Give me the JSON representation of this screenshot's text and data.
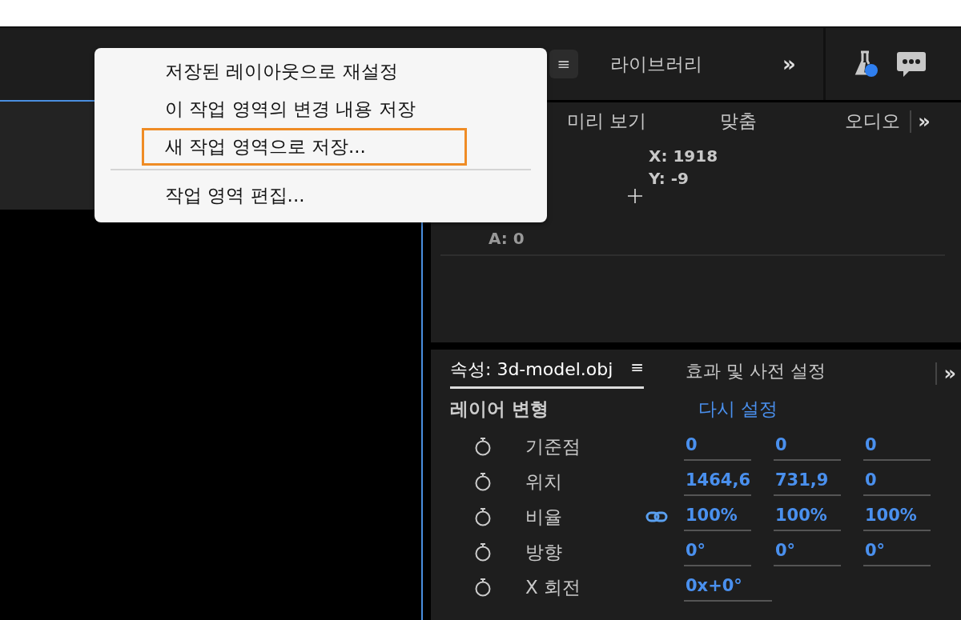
{
  "workspace_bar": {
    "menu_button": "≡",
    "tabs": [
      {
        "label": "라이브러리",
        "selected": false
      }
    ],
    "overflow": "»"
  },
  "workspace_menu": {
    "items": [
      {
        "kind": "item",
        "label": "저장된 레이아웃으로 재설정",
        "selected": false
      },
      {
        "kind": "item",
        "label": "이 작업 영역의 변경 내용 저장",
        "selected": false
      },
      {
        "kind": "item",
        "label": "새 작업 영역으로 저장...",
        "selected": true
      },
      {
        "kind": "separator"
      },
      {
        "kind": "item",
        "label": "작업 영역 편집...",
        "selected": false
      }
    ]
  },
  "info_panel": {
    "tabs": [
      {
        "label": "미리 보기",
        "selected": false
      },
      {
        "label": "맞춤",
        "selected": false
      },
      {
        "label": "오디오",
        "selected": false
      }
    ],
    "overflow": "»",
    "x": "X: 1918",
    "y": "Y: -9",
    "alpha": "A: 0"
  },
  "properties_panel": {
    "tabs": [
      {
        "label": "속성: 3d-model.obj",
        "selected": true,
        "menu": "≡"
      },
      {
        "label": "효과 및 사전 설정",
        "selected": false
      }
    ],
    "overflow": "»",
    "section": "레이어 변형",
    "reset": "다시 설정",
    "rows": [
      {
        "label": "기준점",
        "linked": false,
        "values": [
          "0",
          "0",
          "0"
        ]
      },
      {
        "label": "위치",
        "linked": false,
        "values": [
          "1464,6",
          "731,9",
          "0"
        ]
      },
      {
        "label": "비율",
        "linked": true,
        "values": [
          "100%",
          "100%",
          "100%"
        ]
      },
      {
        "label": "방향",
        "linked": false,
        "values": [
          "0°",
          "0°",
          "0°"
        ]
      },
      {
        "label": "X 회전",
        "linked": false,
        "values": [
          "0x+0°"
        ]
      }
    ]
  }
}
